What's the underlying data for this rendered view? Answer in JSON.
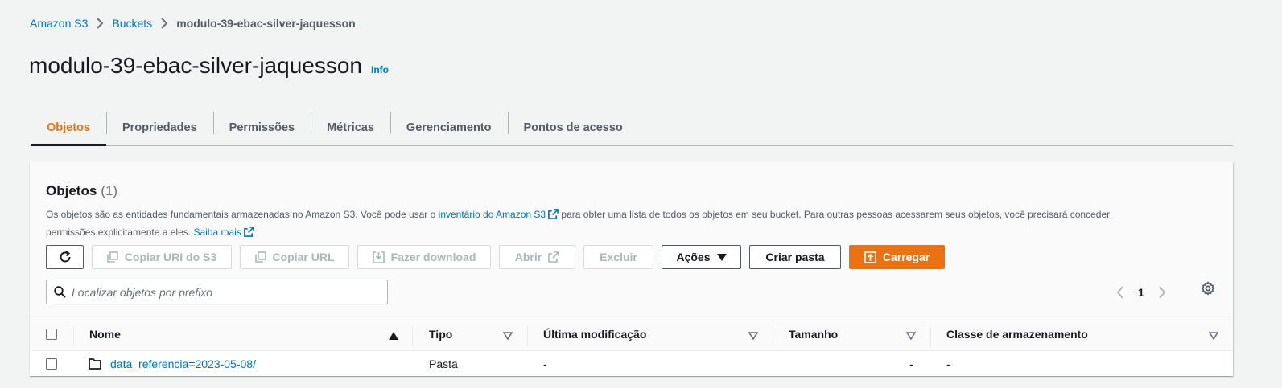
{
  "breadcrumb": {
    "root": "Amazon S3",
    "buckets": "Buckets",
    "current": "modulo-39-ebac-silver-jaquesson"
  },
  "header": {
    "title": "modulo-39-ebac-silver-jaquesson",
    "info": "Info"
  },
  "tabs": [
    {
      "label": "Objetos",
      "active": true
    },
    {
      "label": "Propriedades"
    },
    {
      "label": "Permissões"
    },
    {
      "label": "Métricas"
    },
    {
      "label": "Gerenciamento"
    },
    {
      "label": "Pontos de acesso"
    }
  ],
  "objects_panel": {
    "title": "Objetos",
    "count": "(1)",
    "desc_part1": "Os objetos são as entidades fundamentais armazenadas no Amazon S3. Você pode usar o",
    "desc_link1": "inventário do Amazon S3",
    "desc_part2": "para obter uma lista de todos os objetos em seu bucket. Para outras pessoas acessarem seus objetos, você precisará conceder permissões explicitamente a eles.",
    "desc_link2": "Saiba mais"
  },
  "toolbar": {
    "refresh_icon": "refresh-icon",
    "copy_uri": "Copiar URI do S3",
    "copy_url": "Copiar URL",
    "download": "Fazer download",
    "open": "Abrir",
    "delete": "Excluir",
    "actions": "Ações",
    "create_folder": "Criar pasta",
    "upload": "Carregar"
  },
  "search": {
    "placeholder": "Localizar objetos por prefixo"
  },
  "pagination": {
    "page": "1"
  },
  "table": {
    "columns": [
      "Nome",
      "Tipo",
      "Última modificação",
      "Tamanho",
      "Classe de armazenamento"
    ],
    "rows": [
      {
        "name": "data_referencia=2023-05-08/",
        "type": "Pasta",
        "modified": "-",
        "size": "-",
        "class": "-"
      }
    ]
  },
  "colors": {
    "accent": "#ec7211",
    "link": "#0073bb",
    "text": "#16191f"
  }
}
